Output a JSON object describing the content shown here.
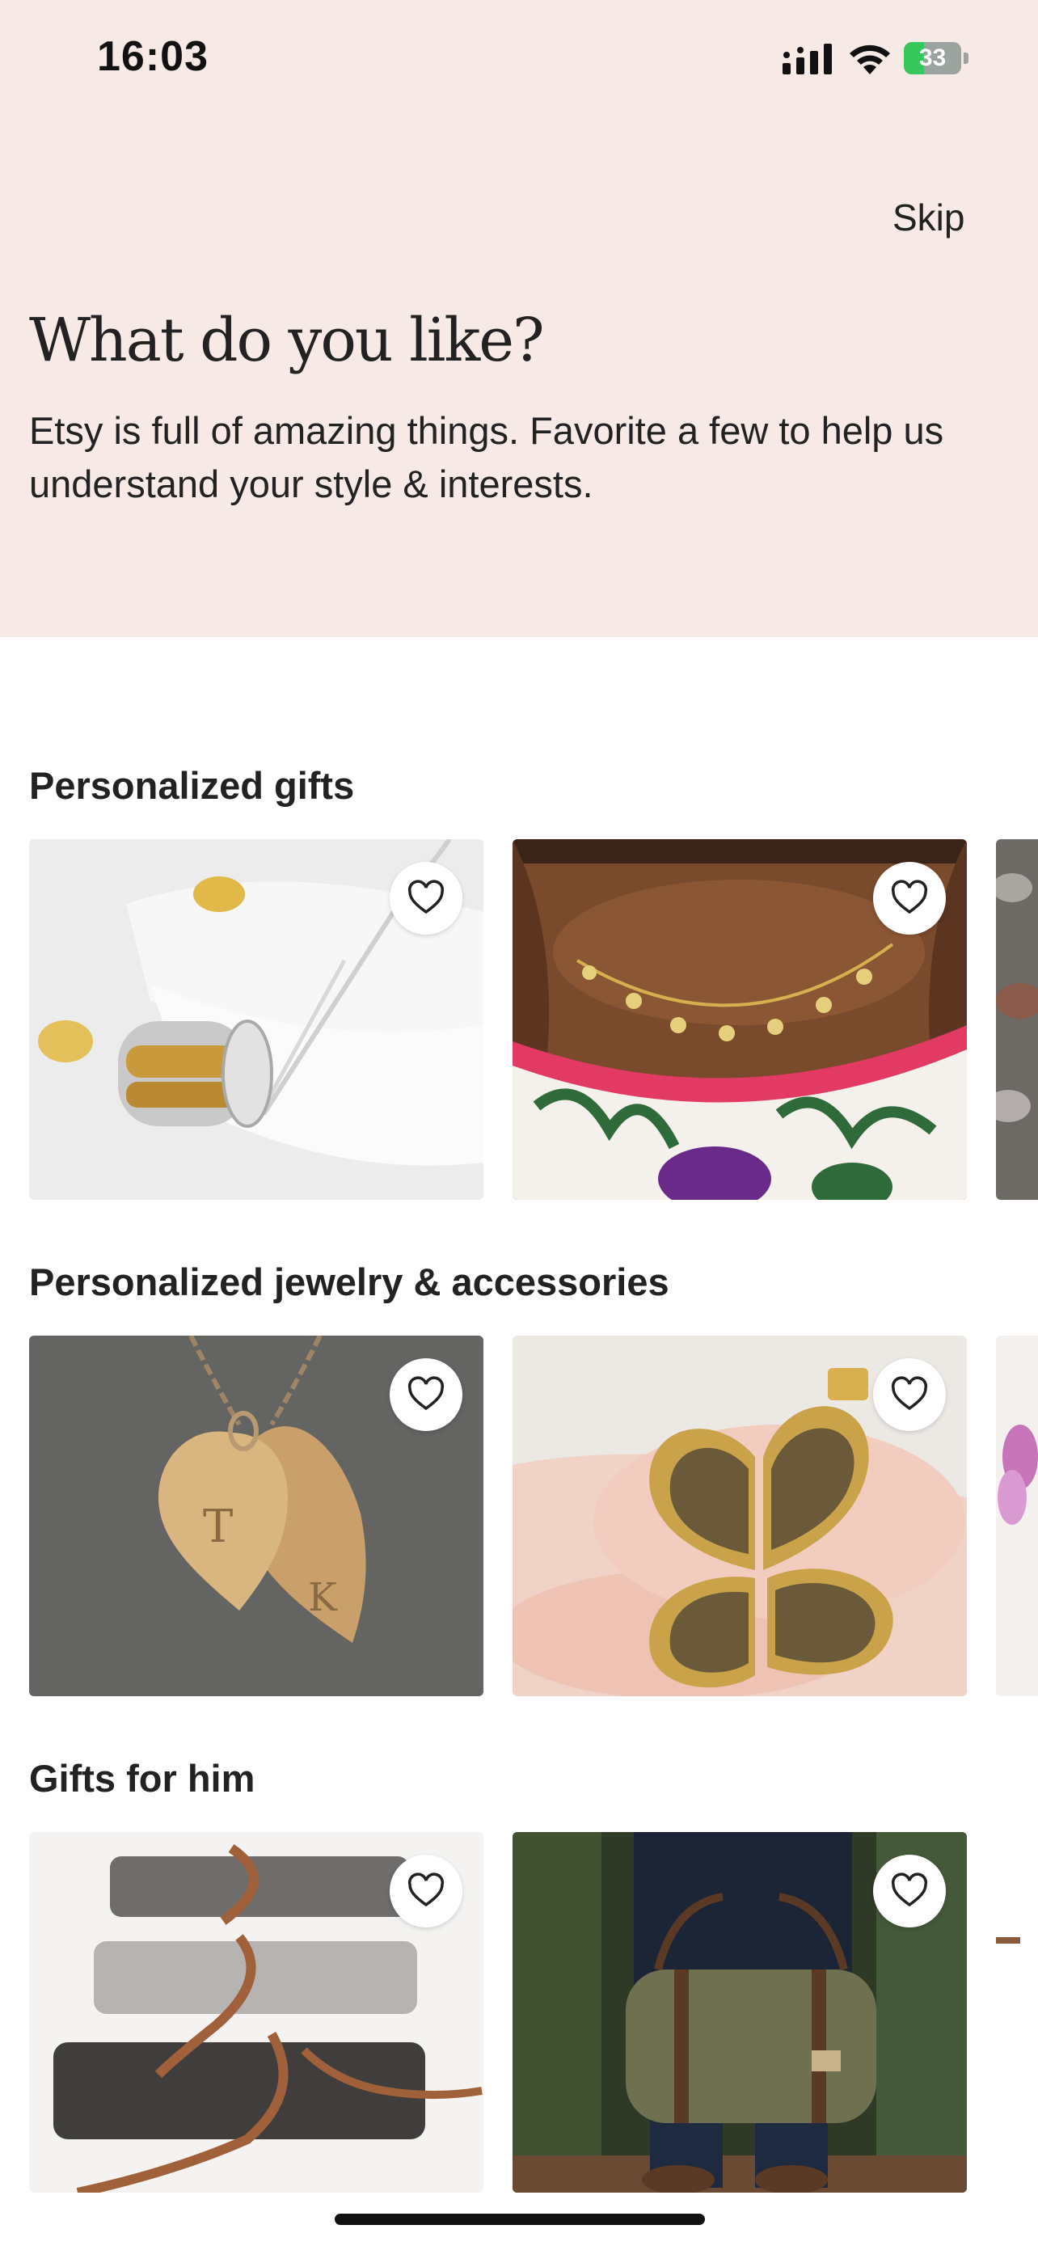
{
  "status_bar": {
    "time": "16:03",
    "battery": "33"
  },
  "header": {
    "skip_label": "Skip",
    "title": "What do you like?",
    "subtitle": "Etsy is full of amazing things. Favorite a few to help us understand your style & interests."
  },
  "sections": [
    {
      "title": "Personalized gifts",
      "items": [
        "spinner-ring-necklace",
        "name-necklace",
        "pebble-art"
      ]
    },
    {
      "title": "Personalized jewelry & accessories",
      "items": [
        "initial-heart-pendants",
        "heart-clover-locket",
        "flower-item"
      ]
    },
    {
      "title": "Gifts for him",
      "items": [
        "felt-leather-pouches",
        "canvas-duffle-bag",
        "leather-cord-item"
      ]
    }
  ],
  "icons": {
    "favorite": "heart-outline-icon",
    "signal": "cellular-signal-icon",
    "wifi": "wifi-icon",
    "battery": "battery-charging-icon"
  },
  "colors": {
    "hero_background": "#f6e9e6",
    "battery_green": "#35c759",
    "text": "#222222"
  }
}
